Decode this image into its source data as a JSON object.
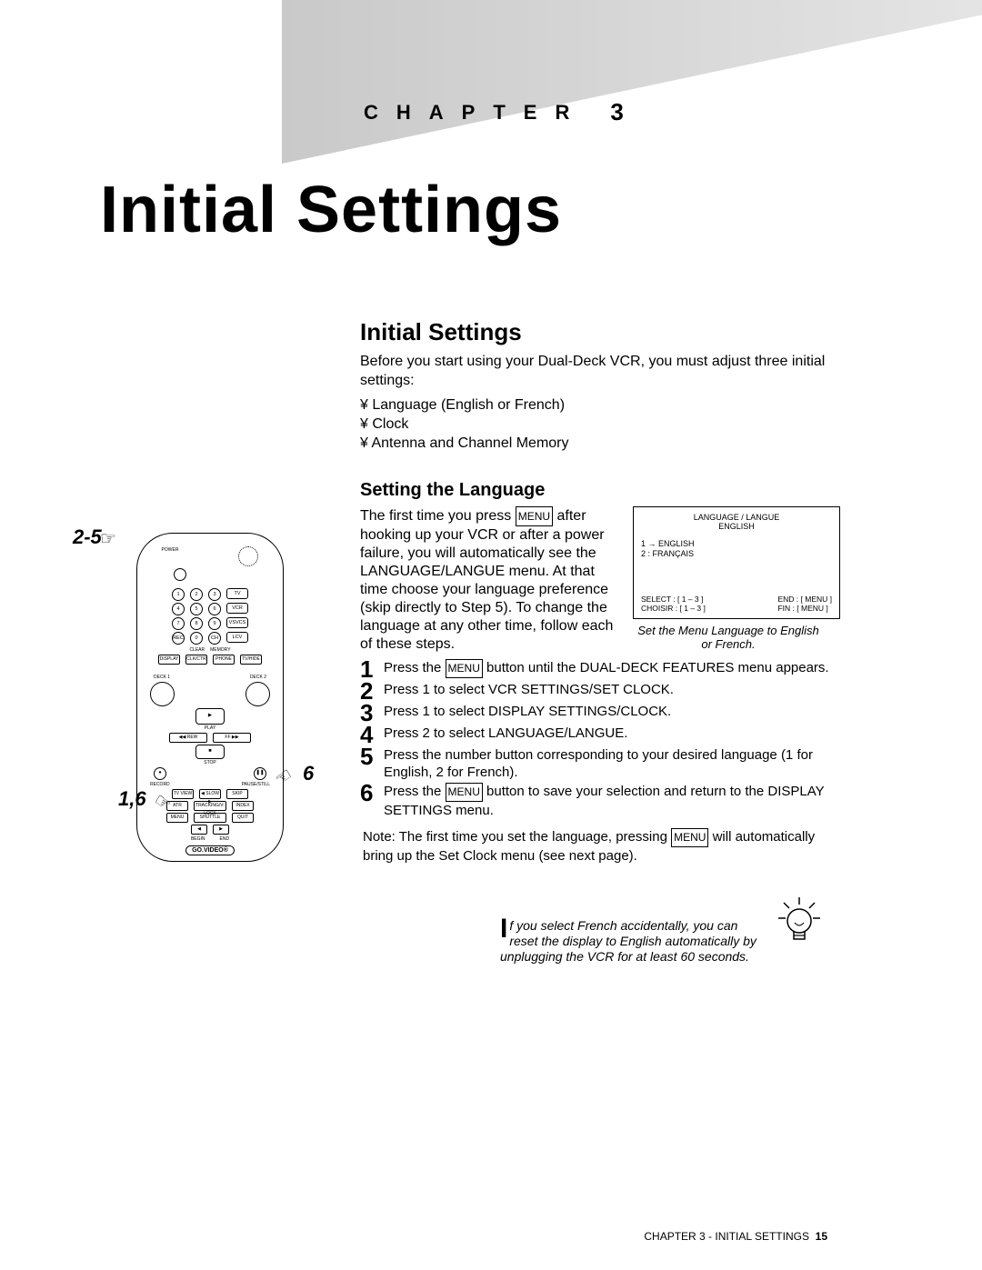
{
  "chapter": {
    "label": "CHAPTER",
    "number": "3"
  },
  "title": "Initial Settings",
  "section": {
    "heading": "Initial Settings",
    "intro": "Before you start using your Dual-Deck VCR, you must adjust three initial settings:",
    "bullets": [
      "Language (English or French)",
      "Clock",
      "Antenna and Channel Memory"
    ]
  },
  "setlang": {
    "heading": "Setting the Language",
    "para_before_menu": "The first time you press ",
    "menu_key": "MENU",
    "para_after_menu": " after hooking up your VCR or after a power failure, you will automatically see the LANGUAGE/LANGUE menu. At that time choose your language preference (skip directly to Step 5). To change the language at any other time, follow each of these steps.",
    "osd": {
      "title": "LANGUAGE / LANGUE",
      "subtitle": "ENGLISH",
      "opt1": "1 → ENGLISH",
      "opt2": "2  :  FRANÇAIS",
      "select": "SELECT : [ 1 – 3 ]",
      "end": "END : [ MENU ]",
      "choisir": "CHOISIR : [ 1 – 3 ]",
      "fin": "FIN : [ MENU ]"
    },
    "osd_caption": "Set the Menu Language to English or French.",
    "steps": [
      {
        "n": "1",
        "before": "Press the ",
        "key": "MENU",
        "after": " button until the DUAL-DECK FEATURES menu appears."
      },
      {
        "n": "2",
        "text": "Press 1 to select VCR SETTINGS/SET CLOCK."
      },
      {
        "n": "3",
        "text": "Press 1 to select DISPLAY SETTINGS/CLOCK."
      },
      {
        "n": "4",
        "text": "Press 2 to select LANGUAGE/LANGUE."
      },
      {
        "n": "5",
        "text": "Press the number button corresponding to your desired language (1 for English, 2 for French)."
      },
      {
        "n": "6",
        "before": "Press the ",
        "key": "MENU",
        "after": " button to save your selection and return to the DISPLAY SETTINGS menu."
      }
    ],
    "note_before": "Note: The first time you set the language, pressing ",
    "note_key": "MENU",
    "note_after": " will automatically bring up the Set Clock menu (see next page)."
  },
  "callouts": {
    "a": "2-5",
    "b": "1,6",
    "c": "6"
  },
  "remote": {
    "power": "POWER",
    "tv": "TV",
    "vcr": "VCR",
    "vsvcs": "VSVCS",
    "lcv": "LCV",
    "clear": "CLEAR",
    "memory": "MEMORY",
    "display": "DISPLAY",
    "clkctr": "CLK/CTR",
    "phone": "PHONE",
    "tvhide": "TV/HIDE",
    "deck1": "DECK 1",
    "deck2": "DECK 2",
    "play": "PLAY",
    "rew": "◀◀ REW",
    "ff": "FF ▶▶",
    "stop": "STOP",
    "record": "RECORD",
    "pause": "PAUSE/STILL",
    "tvview": "TV VIEW",
    "slow": "◀ SLOW ▶",
    "skip": "SKIP",
    "atr": "ATR",
    "tracking": "TRACKING/V-LOCK",
    "index": "INDEX",
    "menu": "MENU",
    "shuttle": "SHUTTLE",
    "quit": "QUIT",
    "begin": "BEGIN",
    "end": "END",
    "brand": "GO.VIDEO®"
  },
  "tip": {
    "lead": "I",
    "text": "f you select French accidentally, you can reset the display to English automatically by unplugging the VCR for at least 60 seconds."
  },
  "footer": {
    "text": "CHAPTER 3 - INITIAL SETTINGS",
    "page": "15"
  }
}
